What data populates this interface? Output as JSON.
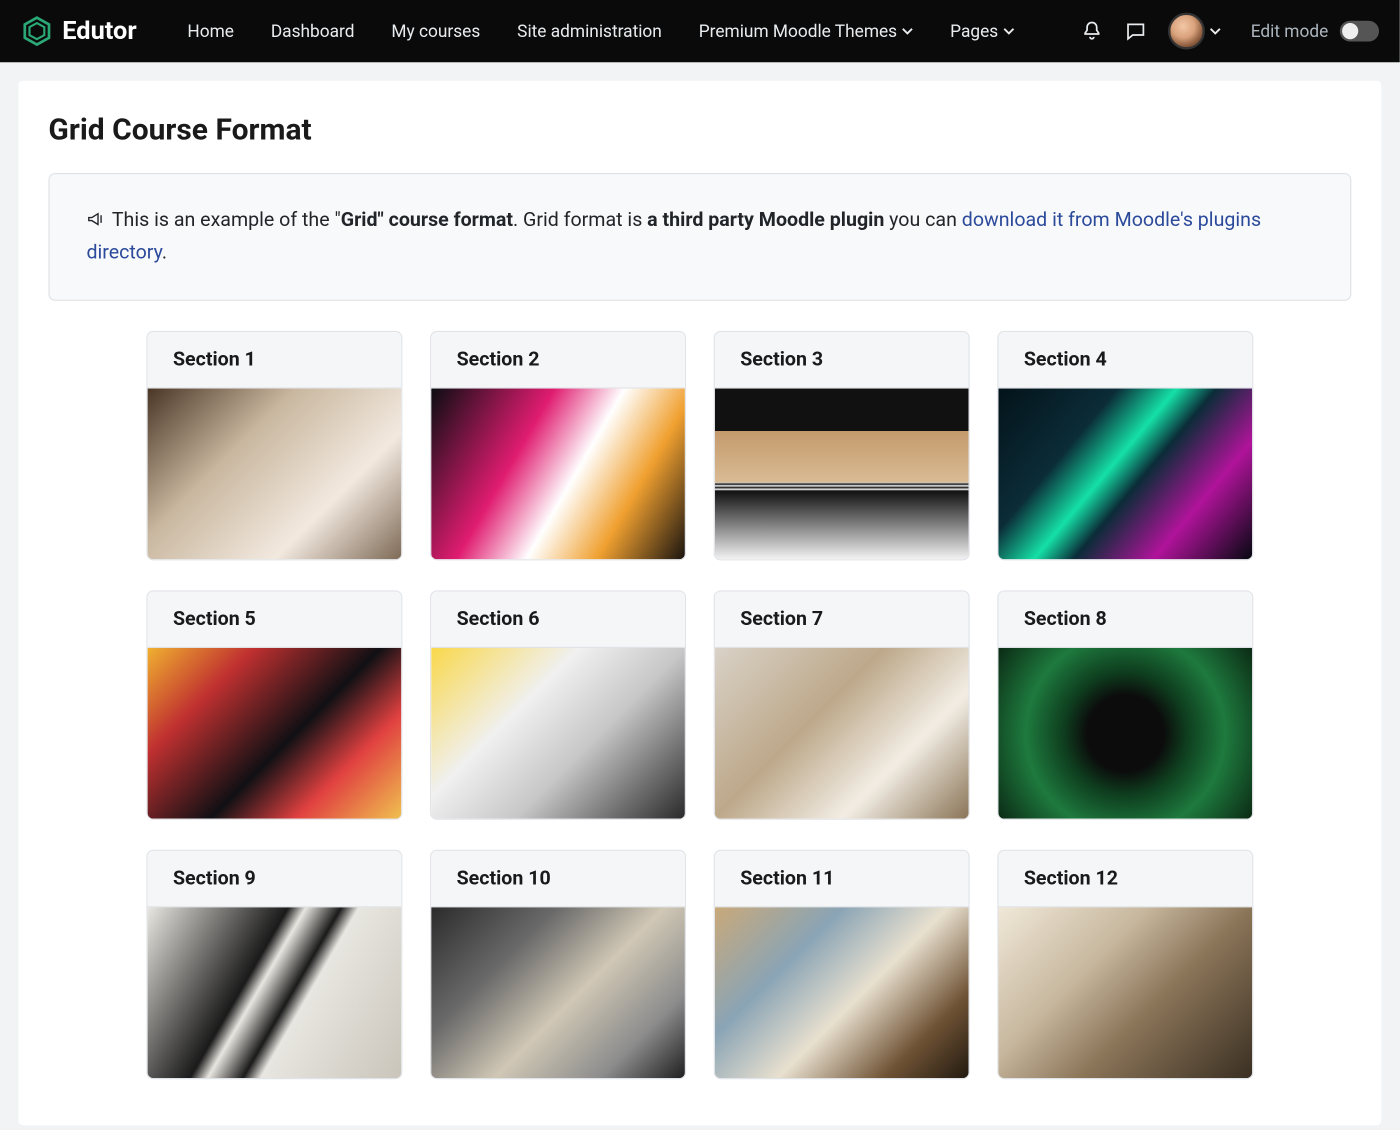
{
  "brand": {
    "name": "Edutor"
  },
  "nav": {
    "items": [
      {
        "label": "Home",
        "dropdown": false
      },
      {
        "label": "Dashboard",
        "dropdown": false
      },
      {
        "label": "My courses",
        "dropdown": false
      },
      {
        "label": "Site administration",
        "dropdown": false
      },
      {
        "label": "Premium Moodle Themes",
        "dropdown": true
      },
      {
        "label": "Pages",
        "dropdown": true
      }
    ],
    "edit_mode_label": "Edit mode"
  },
  "page": {
    "title": "Grid Course Format",
    "notice_pre": "This is an example of the \"",
    "notice_bold1": "Grid\" course format",
    "notice_mid": ". Grid format is ",
    "notice_bold2": "a third party Moodle plugin",
    "notice_post": " you can ",
    "notice_link": "download it from Moodle's plugins directory",
    "notice_period": "."
  },
  "sections": [
    {
      "label": "Section 1"
    },
    {
      "label": "Section 2"
    },
    {
      "label": "Section 3"
    },
    {
      "label": "Section 4"
    },
    {
      "label": "Section 5"
    },
    {
      "label": "Section 6"
    },
    {
      "label": "Section 7"
    },
    {
      "label": "Section 8"
    },
    {
      "label": "Section 9"
    },
    {
      "label": "Section 10"
    },
    {
      "label": "Section 11"
    },
    {
      "label": "Section 12"
    }
  ]
}
